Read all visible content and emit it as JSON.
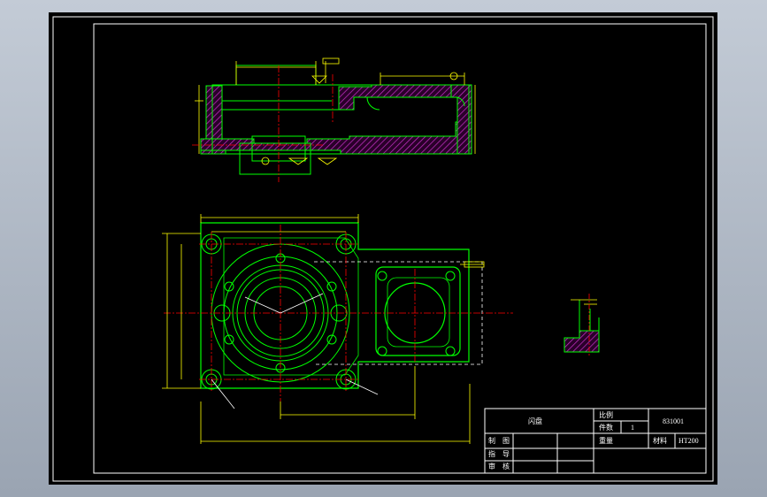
{
  "title_block": {
    "part_name": "闪盘",
    "scale_label": "比例",
    "quantity_label": "件数",
    "quantity_value": "1",
    "drawing_no": "831001",
    "drawn_label": "制　图",
    "guide_label": "指　导",
    "review_label": "审　核",
    "weight_label": "重量",
    "material_label": "材料",
    "material_value": "HT200"
  },
  "colors": {
    "sheet": "#000000",
    "border": "#ffffff",
    "outline": "#00ff00",
    "dimension": "#ffff00",
    "centerline": "#ff0000",
    "hatch": "#cc33cc"
  }
}
